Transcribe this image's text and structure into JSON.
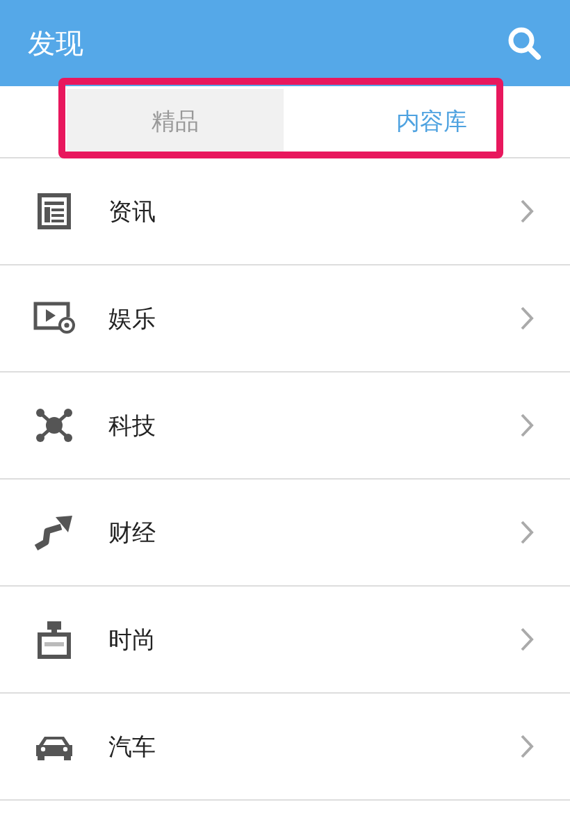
{
  "header": {
    "title": "发现"
  },
  "tabs": [
    {
      "label": "精品",
      "selected": false
    },
    {
      "label": "内容库",
      "selected": true
    }
  ],
  "categories": [
    {
      "label": "资讯"
    },
    {
      "label": "娱乐"
    },
    {
      "label": "科技"
    },
    {
      "label": "财经"
    },
    {
      "label": "时尚"
    },
    {
      "label": "汽车"
    }
  ]
}
